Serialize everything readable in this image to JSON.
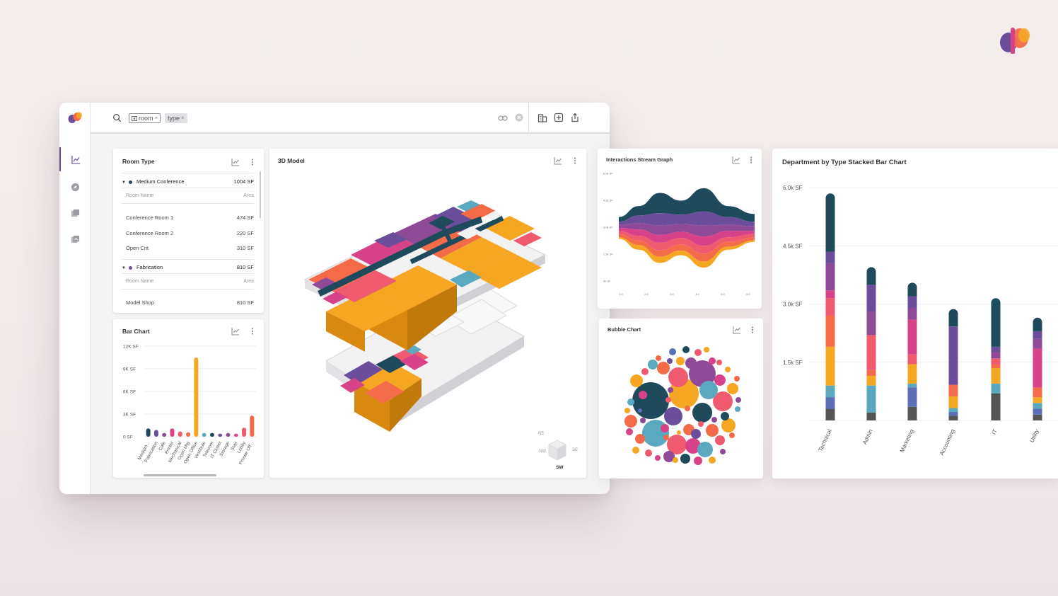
{
  "search": {
    "chips": [
      {
        "label": "room",
        "remove": "×"
      },
      {
        "label": "type",
        "remove": "×"
      }
    ]
  },
  "room_type_card": {
    "title": "Room Type",
    "groups": [
      {
        "name": "Medium Conference",
        "area": "1004 SF",
        "color": "#1f4a5c",
        "col_name": "Room Name",
        "col_area": "Area",
        "rows": [
          {
            "name": "Conference Room 1",
            "area": "474 SF"
          },
          {
            "name": "Conference Room 2",
            "area": "220 SF"
          },
          {
            "name": "Open Crit",
            "area": "310 SF"
          }
        ]
      },
      {
        "name": "Fabrication",
        "area": "810 SF",
        "color": "#6b4e9b",
        "col_name": "Room Name",
        "col_area": "Area",
        "rows": [
          {
            "name": "Model Shop",
            "area": "810 SF"
          }
        ]
      }
    ]
  },
  "bar_chart_card": {
    "title": "Bar Chart"
  },
  "model_card": {
    "title": "3D Model",
    "compass": {
      "ne": "NE",
      "nw": "NW",
      "se": "SE",
      "sw": "SW"
    }
  },
  "stream_card": {
    "title": "Interactions Stream Graph"
  },
  "bubble_card": {
    "title": "Bubble Chart"
  },
  "stacked_card": {
    "title": "Department by Type Stacked Bar Chart"
  },
  "chart_data": [
    {
      "type": "bar",
      "title": "Bar Chart",
      "categories": [
        "Medium...",
        "Fabrication",
        "Cafe",
        "Printer",
        "Mechanical",
        "Open Mtg",
        "Open Office",
        "Vestibule",
        "Telecom",
        "IT Closet",
        "Storage",
        "Stair",
        "Lobby",
        "Private Off..."
      ],
      "values": [
        1100,
        900,
        500,
        1100,
        700,
        600,
        10500,
        500,
        500,
        400,
        500,
        400,
        1200,
        2800
      ],
      "colors": [
        "#1f4a5c",
        "#6b4e9b",
        "#8e4a96",
        "#d74289",
        "#ef5a6f",
        "#f36b49",
        "#f5a623",
        "#5aa9c0",
        "#1f4a5c",
        "#6b4e9b",
        "#8e4a96",
        "#d74289",
        "#ef5a6f",
        "#f36b49"
      ],
      "ylim": [
        0,
        12000
      ],
      "yticks": [
        "0 SF",
        "3K SF",
        "6K SF",
        "9K SF",
        "12K SF"
      ],
      "tick_values": [
        0,
        3000,
        6000,
        9000,
        12000
      ]
    },
    {
      "type": "area",
      "title": "Interactions Stream Graph",
      "yticks": [
        "6.0k SF",
        "4.5k SF",
        "3.0k SF",
        "1.5k SF",
        "0k SF"
      ],
      "xticks": [
        "1.0",
        "2.0",
        "3.0",
        "4.0",
        "5.0",
        "6.0"
      ],
      "series": [
        {
          "color": "#1f4a5c",
          "values": [
            3,
            6,
            13,
            9,
            15,
            7,
            5
          ]
        },
        {
          "color": "#6b4e9b",
          "values": [
            2,
            5,
            8,
            6,
            9,
            5,
            3
          ]
        },
        {
          "color": "#8e4a96",
          "values": [
            2,
            4,
            6,
            5,
            7,
            4,
            3
          ]
        },
        {
          "color": "#d74289",
          "values": [
            2,
            4,
            5,
            4,
            6,
            4,
            2
          ]
        },
        {
          "color": "#ef5a6f",
          "values": [
            2,
            3,
            5,
            4,
            5,
            3,
            2
          ]
        },
        {
          "color": "#f36b49",
          "values": [
            2,
            3,
            4,
            4,
            5,
            3,
            2
          ]
        },
        {
          "color": "#f5a623",
          "values": [
            1,
            3,
            4,
            3,
            4,
            2,
            1
          ]
        }
      ]
    },
    {
      "type": "scatter",
      "title": "Bubble Chart",
      "palette": [
        "#1f4a5c",
        "#6b4e9b",
        "#8e4a96",
        "#d74289",
        "#ef5a6f",
        "#f36b49",
        "#f5a623",
        "#5aa9c0",
        "#5a6fb5"
      ]
    },
    {
      "type": "bar",
      "title": "Department by Type Stacked Bar Chart",
      "categories": [
        "Technical",
        "Admin",
        "Marketing",
        "Accounting",
        "IT",
        "Utility"
      ],
      "ylim": [
        0,
        6000
      ],
      "yticks": [
        "1.5k SF",
        "3.0k SF",
        "4.5k SF",
        "6.0k SF"
      ],
      "tick_values": [
        1500,
        3000,
        4500,
        6000
      ],
      "series": [
        {
          "color": "#555555",
          "values": [
            300,
            200,
            350,
            120,
            700,
            150
          ]
        },
        {
          "color": "#5a6fb5",
          "values": [
            300,
            0,
            500,
            100,
            0,
            150
          ]
        },
        {
          "color": "#5aa9c0",
          "values": [
            300,
            700,
            100,
            100,
            250,
            150
          ]
        },
        {
          "color": "#f5a623",
          "values": [
            1000,
            250,
            500,
            300,
            400,
            150
          ]
        },
        {
          "color": "#f36b49",
          "values": [
            800,
            150,
            0,
            300,
            100,
            250
          ]
        },
        {
          "color": "#ef5a6f",
          "values": [
            450,
            900,
            250,
            0,
            150,
            0
          ]
        },
        {
          "color": "#d74289",
          "values": [
            200,
            0,
            900,
            0,
            0,
            1000
          ]
        },
        {
          "color": "#8e4a96",
          "values": [
            700,
            600,
            300,
            0,
            150,
            250
          ]
        },
        {
          "color": "#6b4e9b",
          "values": [
            300,
            700,
            300,
            1500,
            150,
            200
          ]
        },
        {
          "color": "#1f4a5c",
          "values": [
            1500,
            450,
            350,
            450,
            1250,
            350
          ]
        }
      ]
    }
  ]
}
